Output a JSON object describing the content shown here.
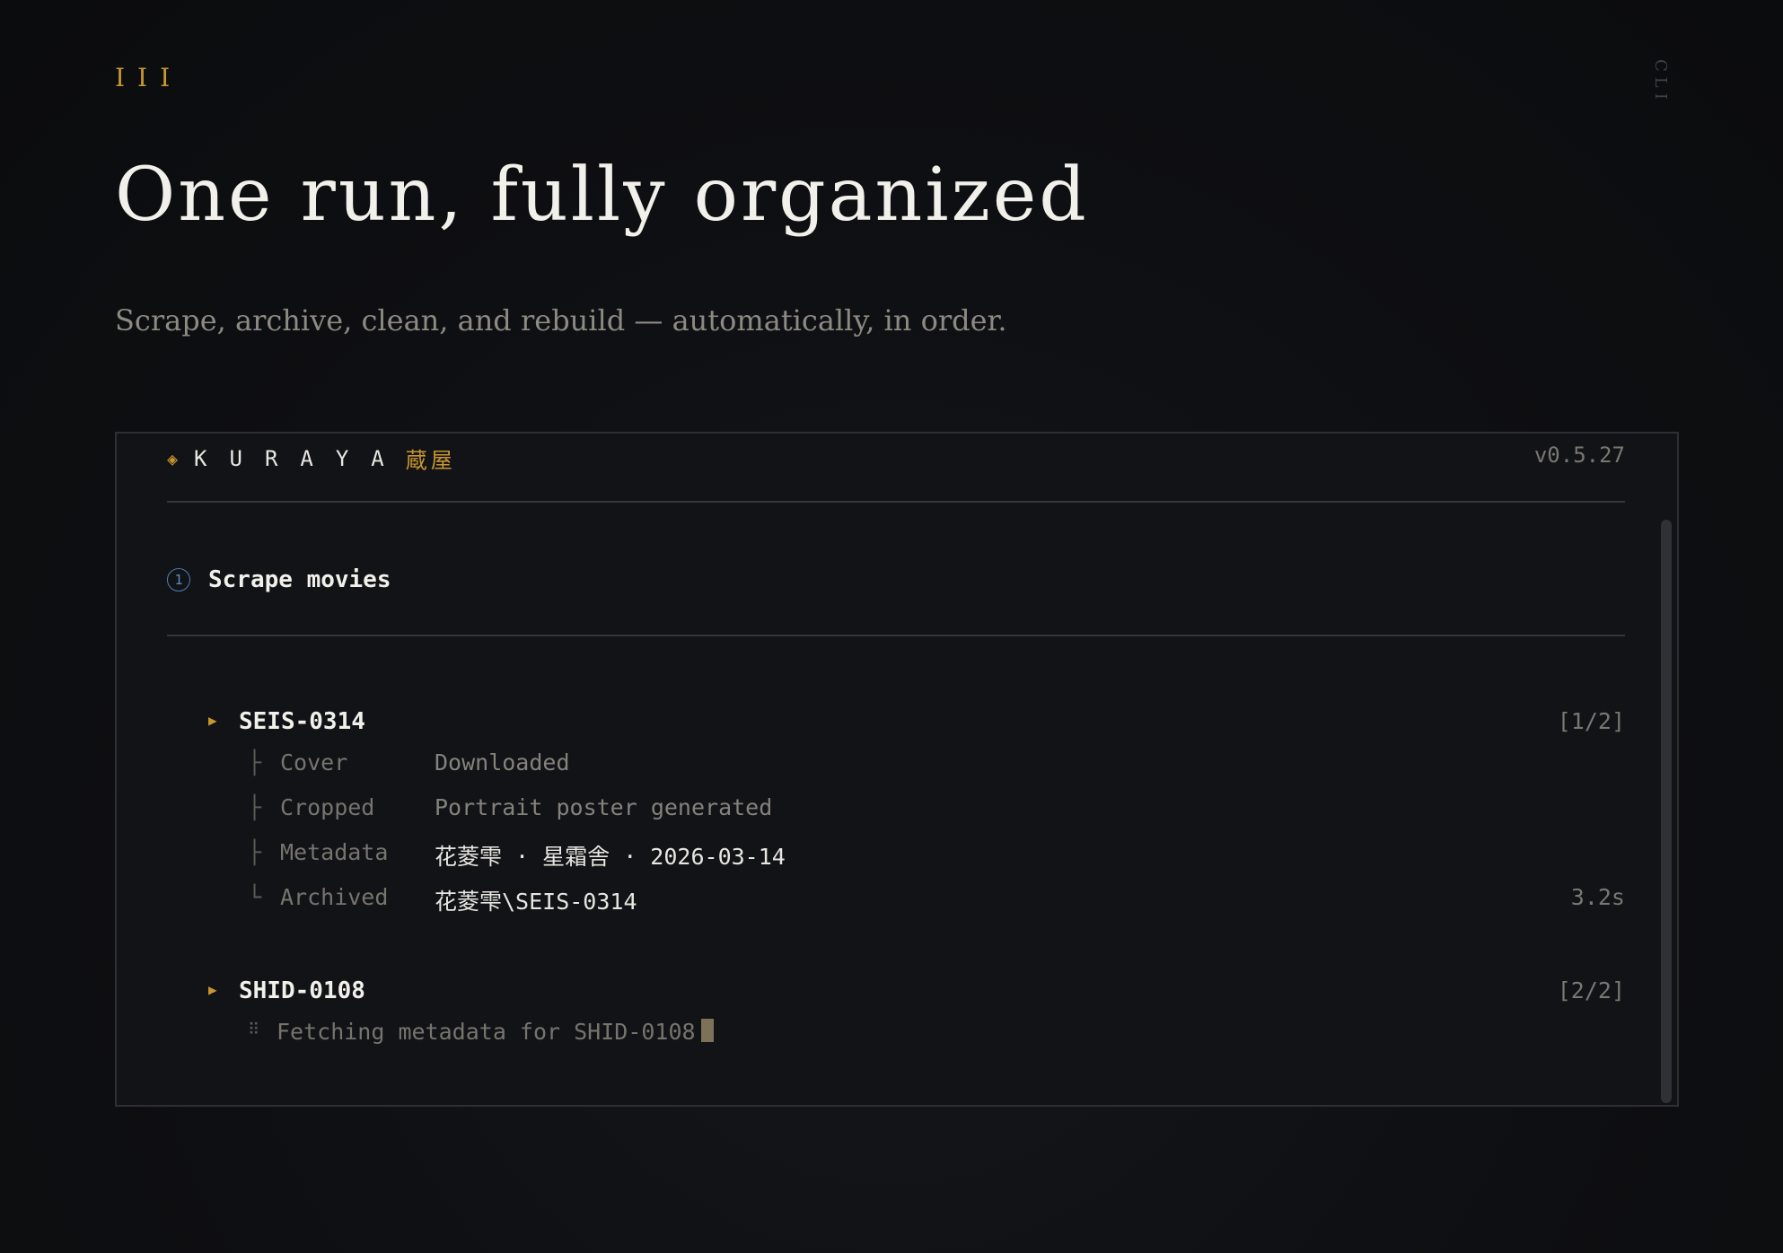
{
  "section": {
    "number": "III",
    "side_tag": "CLI"
  },
  "hero": {
    "title": "One run, fully organized",
    "subtitle": "Scrape, archive, clean, and rebuild — automatically, in order."
  },
  "terminal": {
    "brand_icon": "diamond-icon",
    "brand_name": "KURAYA",
    "brand_kanji": "蔵屋",
    "version": "v0.5.27",
    "step": {
      "number": "1",
      "title": "Scrape movies"
    },
    "tasks": [
      {
        "id": "SEIS-0314",
        "count": "[1/2]",
        "details": [
          {
            "branch": "├",
            "label": "Cover",
            "value": "Downloaded",
            "time": ""
          },
          {
            "branch": "├",
            "label": "Cropped",
            "value": "Portrait poster generated",
            "time": ""
          },
          {
            "branch": "├",
            "label": "Metadata",
            "value": "花菱雫 · 星霜舎 · 2026-03-14",
            "time": ""
          },
          {
            "branch": "└",
            "label": "Archived",
            "value": "花菱雫\\SEIS-0314",
            "time": "3.2s"
          }
        ]
      },
      {
        "id": "SHID-0108",
        "count": "[2/2]",
        "status": "Fetching metadata for SHID-0108"
      }
    ]
  },
  "colors": {
    "accent": "#c8962e",
    "background": "#0e0f12",
    "terminal_bg": "#111317",
    "step_icon": "#4d7fb3"
  }
}
